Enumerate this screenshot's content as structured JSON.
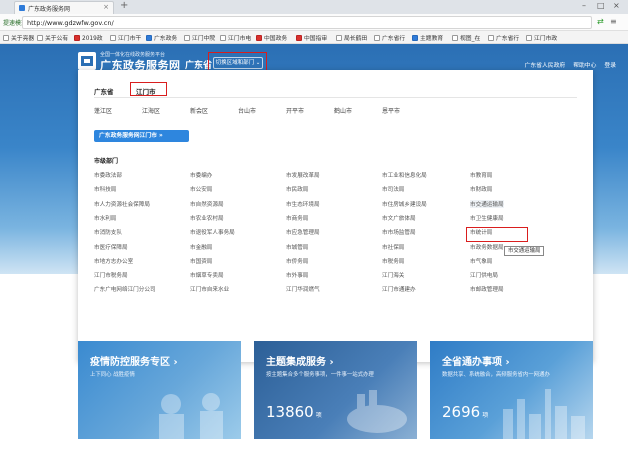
{
  "browser": {
    "tab_title": "广东政务服务网",
    "new_tab": "+",
    "url_prefix": "提速模式",
    "url": "http://www.gdzwfw.gov.cn/",
    "bookmarks": [
      "关于亮器",
      "关于公有",
      "2019政",
      "江门市干",
      "广东政务",
      "江门中院",
      "江门市电",
      "中国政务",
      "中国指审",
      "局长鹤田",
      "广东省行",
      "主题教育",
      "视图_在",
      "广东省行",
      "江门市政"
    ]
  },
  "header": {
    "logo_subtitle": "全国一体化在线政务服务平台",
    "logo_title": "广东政务服务网",
    "region": "广东省",
    "switch_label": "切换区域和部门 ⌄",
    "links": [
      "广东省人民政府",
      "帮助中心",
      "登录"
    ]
  },
  "panel": {
    "province": "广东省",
    "current_city": "江门市",
    "cities": [
      "蓬江区",
      "江海区",
      "新会区",
      "台山市",
      "开平市",
      "鹤山市",
      "恩平市"
    ],
    "service_button": "广东政务服务网江门市 »",
    "dept_title": "市级部门",
    "departments": [
      [
        "市委政法部",
        "市委编办",
        "市发展改革局",
        "市工业和信息化局",
        "市教育局"
      ],
      [
        "市科技局",
        "市公安局",
        "市民政局",
        "市司法局",
        "市财政局"
      ],
      [
        "市人力资源社会保障局",
        "市自然资源局",
        "市生态环境局",
        "市住房城乡建设局",
        "市交通运输局"
      ],
      [
        "市水利局",
        "市农业农村局",
        "市商务局",
        "市文广旅体局",
        "市卫生健康局"
      ],
      [
        "市消防支队",
        "市退役军人事务局",
        "市应急管理局",
        "市市场监管局",
        "市统计局"
      ],
      [
        "市医疗保障局",
        "市金融局",
        "市城管局",
        "市社保局",
        "市政务数据局"
      ],
      [
        "市地方志办公室",
        "市国资局",
        "市侨务局",
        "市税务局",
        "市气象局"
      ],
      [
        "江门市税务局",
        "市烟草专卖局",
        "市外事局",
        "江门海关",
        "江门供电局"
      ],
      [
        "广东广电网络江门分公司",
        "江门市自来水业",
        "江门华润燃气",
        "江门市通建办",
        "市邮政管理局"
      ]
    ],
    "highlighted_dept": "市交通运输局",
    "tooltip": "市交通运输局"
  },
  "cards": [
    {
      "title": "疫情防控服务专区 ›",
      "desc": "上下同心 战胜疫情",
      "number": "",
      "unit": ""
    },
    {
      "title": "主题集成服务 ›",
      "desc": "按主题集合多个服务事项，一件事一站式办理",
      "number": "13860",
      "unit": "项"
    },
    {
      "title": "全省通办事项 ›",
      "desc": "数据共享、系统融合，高频服务省内一网通办",
      "number": "2696",
      "unit": "项"
    }
  ],
  "colors": {
    "banner": "#2b6fb4",
    "highlight_box": "#d91e1e",
    "service_button": "#2e86de"
  }
}
